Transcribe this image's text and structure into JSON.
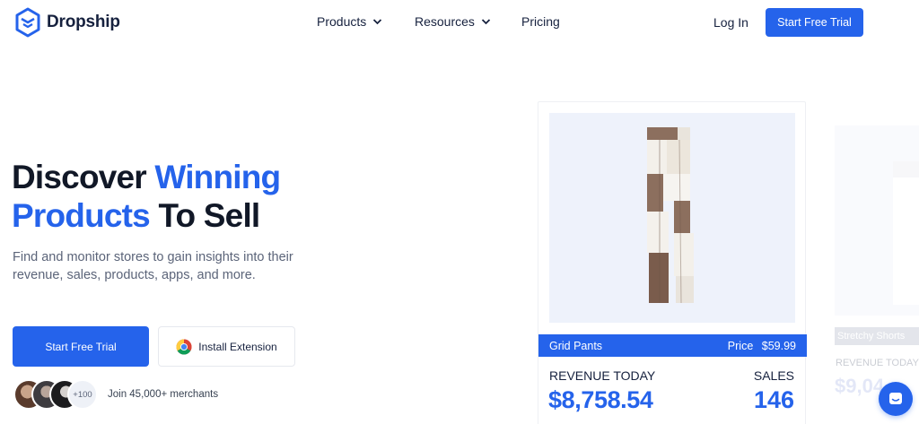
{
  "brand": {
    "name": "Dropship"
  },
  "nav": {
    "items": [
      {
        "label": "Products",
        "has_dropdown": true
      },
      {
        "label": "Resources",
        "has_dropdown": true
      },
      {
        "label": "Pricing",
        "has_dropdown": false
      }
    ],
    "login_label": "Log In",
    "cta_label": "Start Free Trial"
  },
  "hero": {
    "title_part1": "Discover ",
    "title_accent1": "Winning",
    "title_accent2": "Products",
    "title_part2": " To Sell",
    "subtitle": "Find and monitor stores to gain insights into their revenue, sales, products, apps, and more.",
    "primary_button": "Start Free Trial",
    "extension_button": "Install Extension",
    "avatar_more": "+100",
    "join_text": "Join 45,000+ merchants"
  },
  "product_card": {
    "name": "Grid Pants",
    "price_label": "Price",
    "price": "$59.99",
    "revenue_label": "REVENUE TODAY",
    "revenue": "$8,758.54",
    "sales_label": "SALES",
    "sales": "146"
  },
  "product_card_2": {
    "name": "Stretchy Shorts",
    "revenue_label": "REVENUE TODAY",
    "revenue": "$9,04"
  },
  "colors": {
    "accent": "#2563eb",
    "heading": "#111827",
    "muted": "#5b6479"
  },
  "icons": [
    "logo-icon",
    "chevron-down-icon",
    "chrome-icon",
    "chat-icon"
  ]
}
